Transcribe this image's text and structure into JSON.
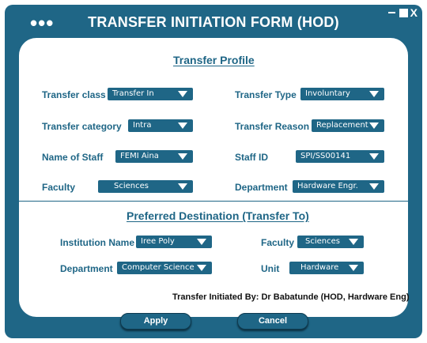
{
  "window": {
    "title": "TRANSFER INITIATION FORM (HOD)",
    "menu_dots": "•••",
    "close_glyph": "X"
  },
  "profile": {
    "heading": "Transfer Profile",
    "fields": {
      "transfer_class": {
        "label": "Transfer class",
        "value": "Transfer In"
      },
      "transfer_type": {
        "label": "Transfer Type",
        "value": "Involuntary"
      },
      "transfer_category": {
        "label": "Transfer category",
        "value": "Intra"
      },
      "transfer_reason": {
        "label": "Transfer Reason",
        "value": "Replacement"
      },
      "staff_name": {
        "label": "Name of Staff",
        "value": "FEMI Aina"
      },
      "staff_id": {
        "label": "Staff ID",
        "value": "SPI/SS00141"
      },
      "faculty": {
        "label": "Faculty",
        "value": "Sciences"
      },
      "department": {
        "label": "Department",
        "value": "Hardware Engr."
      }
    }
  },
  "destination": {
    "heading": "Preferred Destination (Transfer To)",
    "fields": {
      "institution": {
        "label": "Institution Name",
        "value": "Iree Poly"
      },
      "faculty": {
        "label": "Faculty",
        "value": "Sciences"
      },
      "department": {
        "label": "Department",
        "value": "Computer Science"
      },
      "unit": {
        "label": "Unit",
        "value": "Hardware"
      }
    }
  },
  "initiated_by": "Transfer Initiated By: Dr Babatunde (HOD, Hardware Eng)",
  "buttons": {
    "apply": "Apply",
    "cancel": "Cancel"
  },
  "colors": {
    "primary": "#1f6686",
    "background": "#ffffff"
  }
}
